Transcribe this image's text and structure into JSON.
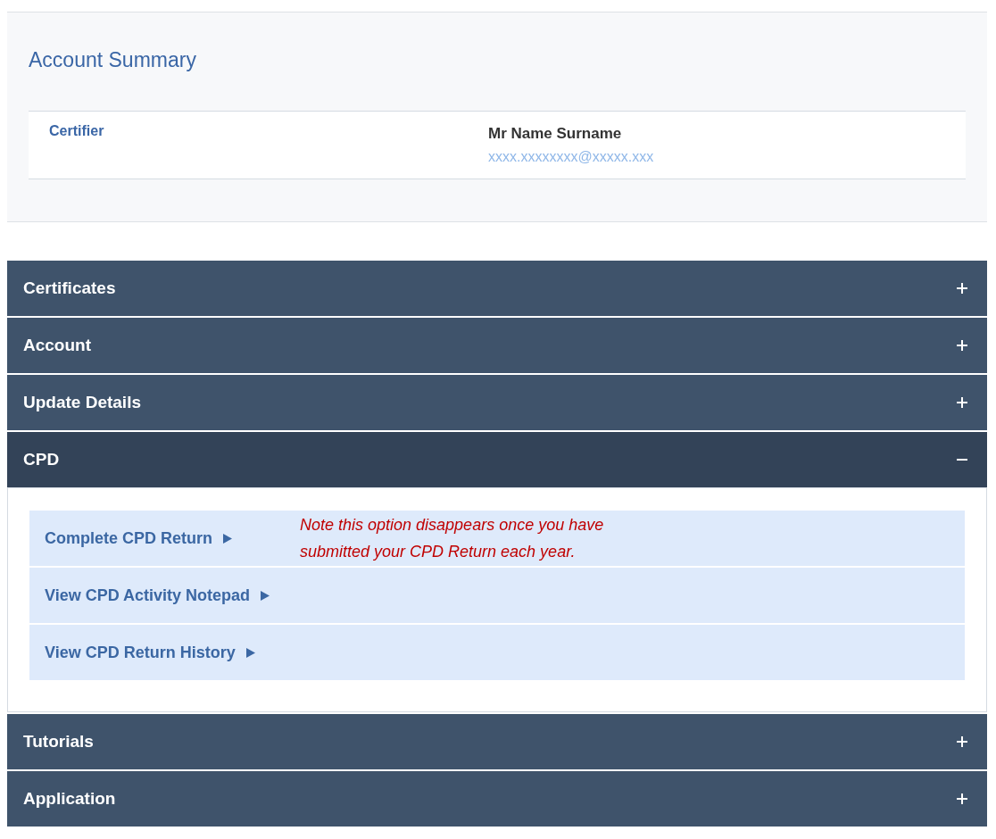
{
  "summary": {
    "title": "Account Summary",
    "role": "Certifier",
    "name": "Mr Name Surname",
    "email": "xxxx.xxxxxxxx@xxxxx.xxx"
  },
  "sections": [
    {
      "label": "Certificates",
      "expanded": false
    },
    {
      "label": "Account",
      "expanded": false
    },
    {
      "label": "Update Details",
      "expanded": false
    },
    {
      "label": "CPD",
      "expanded": true,
      "links": [
        {
          "label": "Complete CPD Return",
          "note": "Note this option disappears once you have submitted your CPD Return each year."
        },
        {
          "label": "View CPD Activity Notepad"
        },
        {
          "label": "View CPD Return History"
        }
      ]
    },
    {
      "label": "Tutorials",
      "expanded": false
    },
    {
      "label": "Application",
      "expanded": false
    }
  ]
}
